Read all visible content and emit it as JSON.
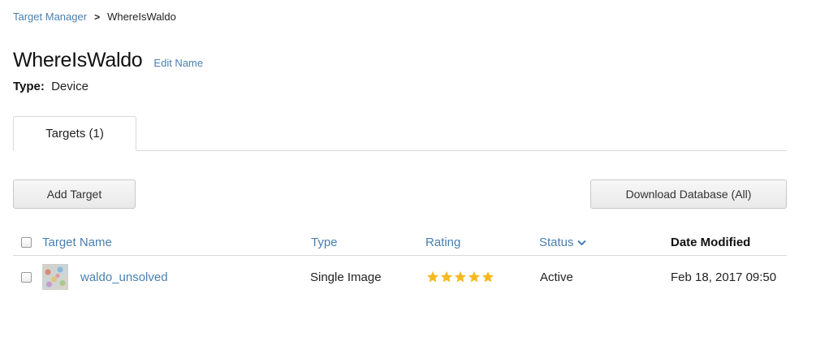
{
  "breadcrumb": {
    "parent": "Target Manager",
    "separator": ">",
    "current": "WhereIsWaldo"
  },
  "header": {
    "title": "WhereIsWaldo",
    "edit_label": "Edit Name",
    "type_label": "Type:",
    "type_value": "Device"
  },
  "tabs": [
    {
      "label": "Targets (1)"
    }
  ],
  "toolbar": {
    "add_label": "Add Target",
    "download_label": "Download Database (All)"
  },
  "table": {
    "columns": {
      "name": "Target Name",
      "type": "Type",
      "rating": "Rating",
      "status": "Status",
      "date": "Date Modified"
    },
    "rows": [
      {
        "name": "waldo_unsolved",
        "type": "Single Image",
        "rating": 5,
        "rating_max": 5,
        "status": "Active",
        "date": "Feb 18, 2017 09:50"
      }
    ]
  },
  "colors": {
    "link": "#4a7fb0",
    "star": "#f5b921",
    "border": "#d9d9d9"
  },
  "icons": {
    "status_sort": "chevron-down-icon",
    "rating": "star-icon"
  }
}
